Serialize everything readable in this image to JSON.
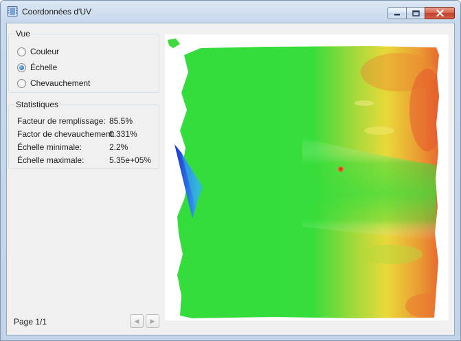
{
  "window": {
    "title": "Coordonnées d'UV",
    "controls": [
      "minimize",
      "maximize",
      "close"
    ]
  },
  "view_group": {
    "title": "Vue",
    "options": [
      {
        "label": "Couleur",
        "selected": false
      },
      {
        "label": "Échelle",
        "selected": true
      },
      {
        "label": "Chevauchement",
        "selected": false
      }
    ]
  },
  "stats_group": {
    "title": "Statistiques",
    "rows": [
      {
        "label": "Facteur de remplissage:",
        "value": "85.5%"
      },
      {
        "label": "Factor de chevauchement:",
        "value": "0.331%"
      },
      {
        "label": "Échelle minimale:",
        "value": "2.2%"
      },
      {
        "label": "Échelle maximale:",
        "value": "5.35e+05%"
      }
    ]
  },
  "viewport": {
    "content": "uv-scale-heatmap",
    "colors": {
      "base": "#33dd3b",
      "high": "#e9582d",
      "mid": "#f0d23a",
      "low": "#2444d8"
    }
  },
  "footer": {
    "page_label": "Page 1/1",
    "prev_icon": "triangle-left-icon",
    "next_icon": "triangle-right-icon"
  }
}
